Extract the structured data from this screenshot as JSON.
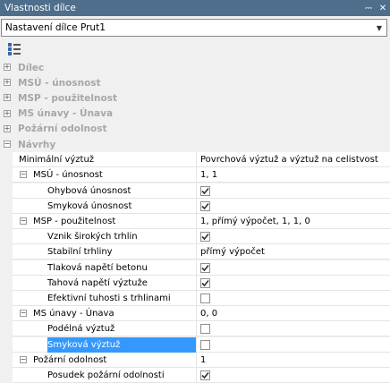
{
  "window": {
    "title": "Vlastnosti dílce",
    "pin_glyph": "⎓",
    "close_glyph": "✕"
  },
  "selector": {
    "value": "Nastavení dílce Prut1"
  },
  "toolbar": {
    "icon": "categorized-view-icon"
  },
  "categories": [
    {
      "label": "Dílec",
      "state": "+"
    },
    {
      "label": "MSÚ - únosnost",
      "state": "+"
    },
    {
      "label": "MSP - použitelnost",
      "state": "+"
    },
    {
      "label": "MS únavy - Únava",
      "state": "+"
    },
    {
      "label": "Požární odolnost",
      "state": "+"
    },
    {
      "label": "Návrhy",
      "state": "−"
    }
  ],
  "properties": [
    {
      "label": "Minimální výztuž",
      "value": "Povrchová výztuž a výztuž na celistvost",
      "level": 0
    },
    {
      "label": "MSÚ - únosnost",
      "value": "1, 1",
      "level": 0,
      "expander": "−"
    },
    {
      "label": "Ohybová únosnost",
      "checked": true,
      "level": 1
    },
    {
      "label": "Smyková únosnost",
      "checked": true,
      "level": 1
    },
    {
      "label": "MSP - použitelnost",
      "value": "1, přímý výpočet, 1, 1, 0",
      "level": 0,
      "expander": "−"
    },
    {
      "label": "Vznik širokých trhlin",
      "checked": true,
      "level": 1
    },
    {
      "label": "Stabilní trhliny",
      "value": "přímý výpočet",
      "level": 1
    },
    {
      "label": "Tlaková napětí betonu",
      "checked": true,
      "level": 1
    },
    {
      "label": "Tahová napětí výztuže",
      "checked": true,
      "level": 1
    },
    {
      "label": "Efektivní tuhosti s trhlinami",
      "checked": false,
      "level": 1
    },
    {
      "label": "MS únavy - Únava",
      "value": "0, 0",
      "level": 0,
      "expander": "−"
    },
    {
      "label": "Podélná výztuž",
      "checked": false,
      "level": 1
    },
    {
      "label": "Smyková výztuž",
      "checked": false,
      "level": 1,
      "selected": true
    },
    {
      "label": "Požární odolnost",
      "value": "1",
      "level": 0,
      "expander": "−"
    },
    {
      "label": "Posudek požární odolnosti",
      "checked": true,
      "level": 1
    }
  ],
  "colors": {
    "titlebar": "#4e6e8c",
    "selection": "#3399ff",
    "category_text": "#a7a7a7"
  }
}
